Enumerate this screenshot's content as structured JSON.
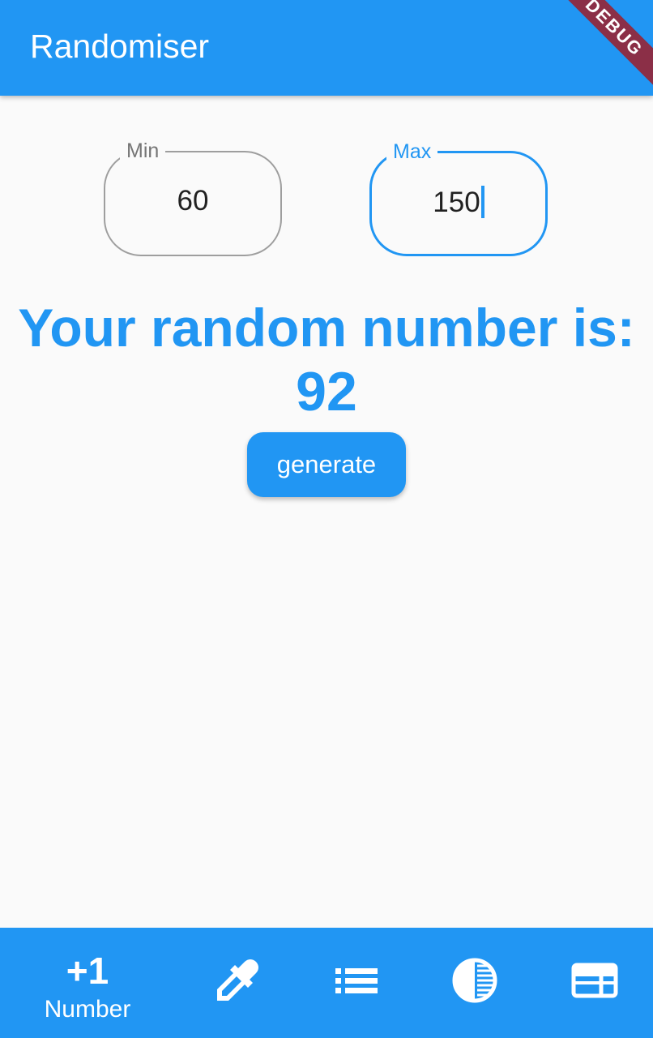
{
  "appbar": {
    "title": "Randomiser",
    "debug_banner": "DEBUG"
  },
  "inputs": {
    "min": {
      "label": "Min",
      "value": "60"
    },
    "max": {
      "label": "Max",
      "value": "150"
    }
  },
  "result": {
    "heading": "Your random number is:",
    "value": "92"
  },
  "generate_button": {
    "label": "generate"
  },
  "bottom_nav": {
    "items": [
      {
        "icon": "plus-one-icon",
        "glyph": "+1",
        "label": "Number"
      },
      {
        "icon": "eyedropper-icon"
      },
      {
        "icon": "list-icon"
      },
      {
        "icon": "contrast-icon"
      },
      {
        "icon": "web-layout-icon"
      }
    ]
  },
  "colors": {
    "primary": "#2196f3",
    "background": "#fafafa",
    "debug_ribbon": "#8b2f47"
  }
}
